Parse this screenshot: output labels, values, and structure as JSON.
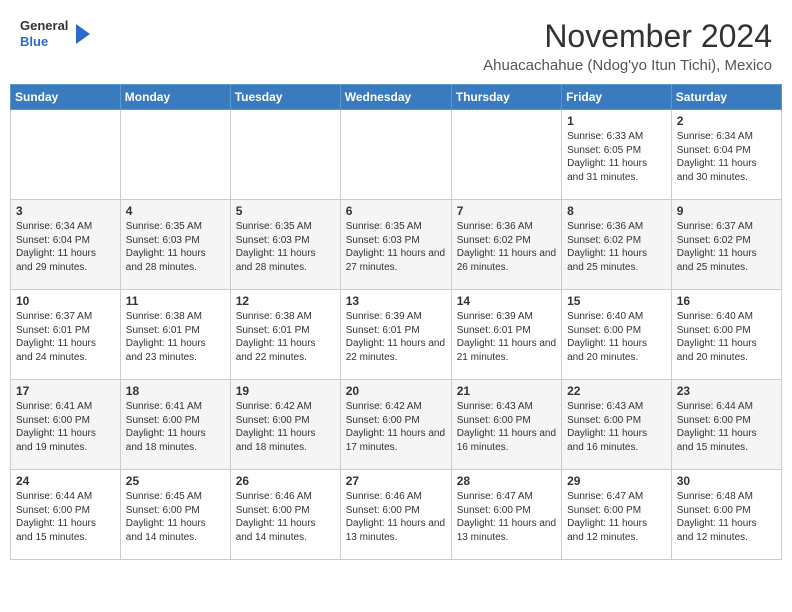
{
  "header": {
    "logo": {
      "general": "General",
      "blue": "Blue"
    },
    "month_year": "November 2024",
    "location": "Ahuacachahue (Ndog'yo Itun Tichi), Mexico"
  },
  "weekdays": [
    "Sunday",
    "Monday",
    "Tuesday",
    "Wednesday",
    "Thursday",
    "Friday",
    "Saturday"
  ],
  "weeks": [
    [
      {
        "day": "",
        "info": ""
      },
      {
        "day": "",
        "info": ""
      },
      {
        "day": "",
        "info": ""
      },
      {
        "day": "",
        "info": ""
      },
      {
        "day": "",
        "info": ""
      },
      {
        "day": "1",
        "info": "Sunrise: 6:33 AM\nSunset: 6:05 PM\nDaylight: 11 hours and 31 minutes."
      },
      {
        "day": "2",
        "info": "Sunrise: 6:34 AM\nSunset: 6:04 PM\nDaylight: 11 hours and 30 minutes."
      }
    ],
    [
      {
        "day": "3",
        "info": "Sunrise: 6:34 AM\nSunset: 6:04 PM\nDaylight: 11 hours and 29 minutes."
      },
      {
        "day": "4",
        "info": "Sunrise: 6:35 AM\nSunset: 6:03 PM\nDaylight: 11 hours and 28 minutes."
      },
      {
        "day": "5",
        "info": "Sunrise: 6:35 AM\nSunset: 6:03 PM\nDaylight: 11 hours and 28 minutes."
      },
      {
        "day": "6",
        "info": "Sunrise: 6:35 AM\nSunset: 6:03 PM\nDaylight: 11 hours and 27 minutes."
      },
      {
        "day": "7",
        "info": "Sunrise: 6:36 AM\nSunset: 6:02 PM\nDaylight: 11 hours and 26 minutes."
      },
      {
        "day": "8",
        "info": "Sunrise: 6:36 AM\nSunset: 6:02 PM\nDaylight: 11 hours and 25 minutes."
      },
      {
        "day": "9",
        "info": "Sunrise: 6:37 AM\nSunset: 6:02 PM\nDaylight: 11 hours and 25 minutes."
      }
    ],
    [
      {
        "day": "10",
        "info": "Sunrise: 6:37 AM\nSunset: 6:01 PM\nDaylight: 11 hours and 24 minutes."
      },
      {
        "day": "11",
        "info": "Sunrise: 6:38 AM\nSunset: 6:01 PM\nDaylight: 11 hours and 23 minutes."
      },
      {
        "day": "12",
        "info": "Sunrise: 6:38 AM\nSunset: 6:01 PM\nDaylight: 11 hours and 22 minutes."
      },
      {
        "day": "13",
        "info": "Sunrise: 6:39 AM\nSunset: 6:01 PM\nDaylight: 11 hours and 22 minutes."
      },
      {
        "day": "14",
        "info": "Sunrise: 6:39 AM\nSunset: 6:01 PM\nDaylight: 11 hours and 21 minutes."
      },
      {
        "day": "15",
        "info": "Sunrise: 6:40 AM\nSunset: 6:00 PM\nDaylight: 11 hours and 20 minutes."
      },
      {
        "day": "16",
        "info": "Sunrise: 6:40 AM\nSunset: 6:00 PM\nDaylight: 11 hours and 20 minutes."
      }
    ],
    [
      {
        "day": "17",
        "info": "Sunrise: 6:41 AM\nSunset: 6:00 PM\nDaylight: 11 hours and 19 minutes."
      },
      {
        "day": "18",
        "info": "Sunrise: 6:41 AM\nSunset: 6:00 PM\nDaylight: 11 hours and 18 minutes."
      },
      {
        "day": "19",
        "info": "Sunrise: 6:42 AM\nSunset: 6:00 PM\nDaylight: 11 hours and 18 minutes."
      },
      {
        "day": "20",
        "info": "Sunrise: 6:42 AM\nSunset: 6:00 PM\nDaylight: 11 hours and 17 minutes."
      },
      {
        "day": "21",
        "info": "Sunrise: 6:43 AM\nSunset: 6:00 PM\nDaylight: 11 hours and 16 minutes."
      },
      {
        "day": "22",
        "info": "Sunrise: 6:43 AM\nSunset: 6:00 PM\nDaylight: 11 hours and 16 minutes."
      },
      {
        "day": "23",
        "info": "Sunrise: 6:44 AM\nSunset: 6:00 PM\nDaylight: 11 hours and 15 minutes."
      }
    ],
    [
      {
        "day": "24",
        "info": "Sunrise: 6:44 AM\nSunset: 6:00 PM\nDaylight: 11 hours and 15 minutes."
      },
      {
        "day": "25",
        "info": "Sunrise: 6:45 AM\nSunset: 6:00 PM\nDaylight: 11 hours and 14 minutes."
      },
      {
        "day": "26",
        "info": "Sunrise: 6:46 AM\nSunset: 6:00 PM\nDaylight: 11 hours and 14 minutes."
      },
      {
        "day": "27",
        "info": "Sunrise: 6:46 AM\nSunset: 6:00 PM\nDaylight: 11 hours and 13 minutes."
      },
      {
        "day": "28",
        "info": "Sunrise: 6:47 AM\nSunset: 6:00 PM\nDaylight: 11 hours and 13 minutes."
      },
      {
        "day": "29",
        "info": "Sunrise: 6:47 AM\nSunset: 6:00 PM\nDaylight: 11 hours and 12 minutes."
      },
      {
        "day": "30",
        "info": "Sunrise: 6:48 AM\nSunset: 6:00 PM\nDaylight: 11 hours and 12 minutes."
      }
    ]
  ]
}
